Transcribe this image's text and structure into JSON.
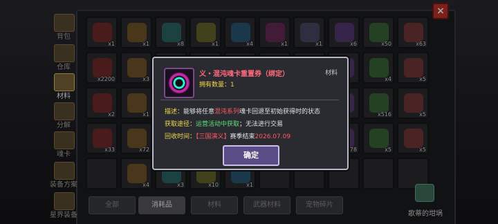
{
  "close_label": "×",
  "tabs": [
    {
      "label": "背包",
      "icon": "backpack-icon",
      "active": false
    },
    {
      "label": "仓库",
      "icon": "warehouse-icon",
      "active": false
    },
    {
      "label": "材料",
      "icon": "materials-icon",
      "active": true
    },
    {
      "label": "分解",
      "icon": "decompose-icon",
      "active": false
    },
    {
      "label": "魂卡",
      "icon": "soul-card-icon",
      "active": false
    },
    {
      "label": "装备方案",
      "icon": "equipment-plan-icon",
      "active": false
    },
    {
      "label": "星界装备",
      "icon": "astral-equipment-icon",
      "active": false
    }
  ],
  "grid_counts": [
    "x1",
    "x1",
    "x8",
    "x1",
    "x4",
    "x1",
    "x1",
    "x6",
    "x50",
    "x63",
    "x2200",
    "x3",
    "",
    "",
    "",
    "",
    "",
    "",
    "x4",
    "x5",
    "x2",
    "x1",
    "",
    "",
    "",
    "",
    "",
    "",
    "x516",
    "x5",
    "x33",
    "x72",
    "",
    "",
    "",
    "",
    "",
    "x278",
    "x5",
    "x5",
    "",
    "x4",
    "x3",
    "x10",
    "x1",
    "",
    "",
    "",
    "",
    ""
  ],
  "filters": [
    {
      "label": "全部",
      "active": false
    },
    {
      "label": "消耗品",
      "active": true
    },
    {
      "label": "材料",
      "active": false
    },
    {
      "label": "武器材料",
      "active": false
    },
    {
      "label": "宠物碎片",
      "active": false
    }
  ],
  "shop_label": "歌蒂的坩埚",
  "dialog": {
    "title": "义・混沌魂卡重置券（绑定）",
    "type": "材料",
    "owned": "拥有数量：1",
    "desc_key": "描述：",
    "desc_a": "能够将任意",
    "desc_b": "混沌系列",
    "desc_c": "魂卡回退至初始获得时的状态",
    "source_key": "获取途径：",
    "source_val": "运营活动中获取",
    "source_tail": "；无法进行交易",
    "recycle_key": "回收时间：",
    "recycle_a": "【三国演义】",
    "recycle_b": "赛季结束",
    "recycle_date": "2026.07.09",
    "confirm": "确定"
  },
  "colors": {
    "title_red": "#ff6a7a",
    "label_yellow": "#f0d84a",
    "highlight_red": "#ff5a64",
    "source_green": "#5ae07a",
    "confirm_purple": "#5a4d86"
  }
}
